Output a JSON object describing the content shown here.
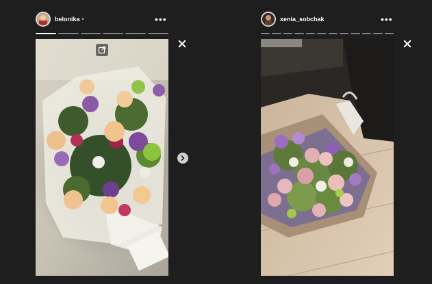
{
  "left_story": {
    "username": "belonika",
    "dot": "•",
    "more": "•••",
    "progress_segments": 6,
    "progress_done": 1
  },
  "right_story": {
    "username": "xenia_sobchak",
    "more": "•••",
    "progress_segments": 12,
    "progress_done": 0
  },
  "icons": {
    "close": "close-icon",
    "next": "chevron-right-icon",
    "share": "share-icon",
    "more": "more-icon"
  },
  "colors": {
    "background": "#1e1e1e",
    "text": "#ffffff"
  }
}
